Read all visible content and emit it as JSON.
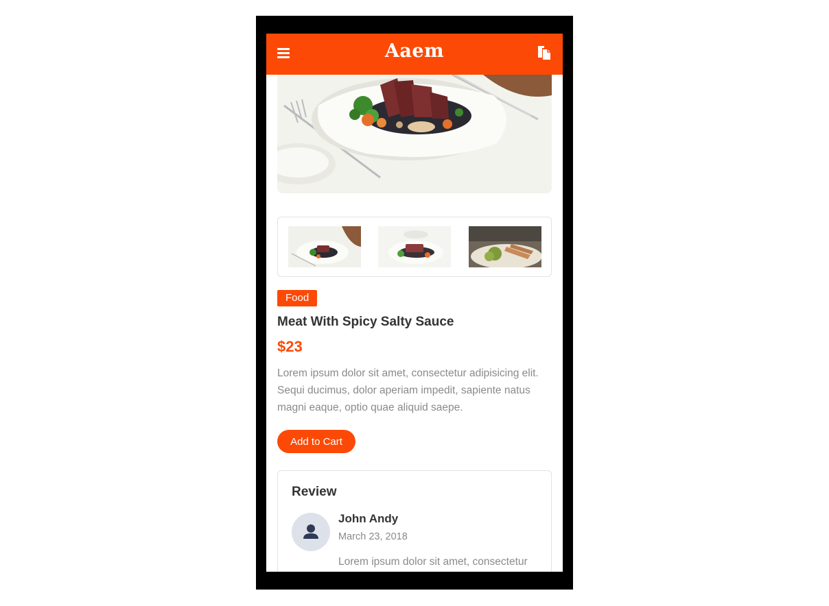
{
  "app_bar": {
    "brand": "Aaem",
    "menu_icon": "hamburger-menu-icon",
    "action_icon": "documents-icon",
    "color": "#fc4a06"
  },
  "product": {
    "category": "Food",
    "title": "Meat With Spicy Salty Sauce",
    "price": "$23",
    "description": "Lorem ipsum dolor sit amet, consectetur adipisicing elit. Sequi ducimus, dolor aperiam impedit, sapiente natus magni eaque, optio quae aliquid saepe.",
    "add_to_cart_label": "Add to Cart"
  },
  "review": {
    "heading": "Review",
    "reviewer_name": "John Andy",
    "date": "March 23, 2018",
    "text": "Lorem ipsum dolor sit amet, consectetur",
    "avatar_icon": "user-icon"
  },
  "colors": {
    "accent": "#fc4a06",
    "text_dark": "#333333",
    "text_muted": "#8a8a8a",
    "avatar_bg": "#dde2ea"
  }
}
